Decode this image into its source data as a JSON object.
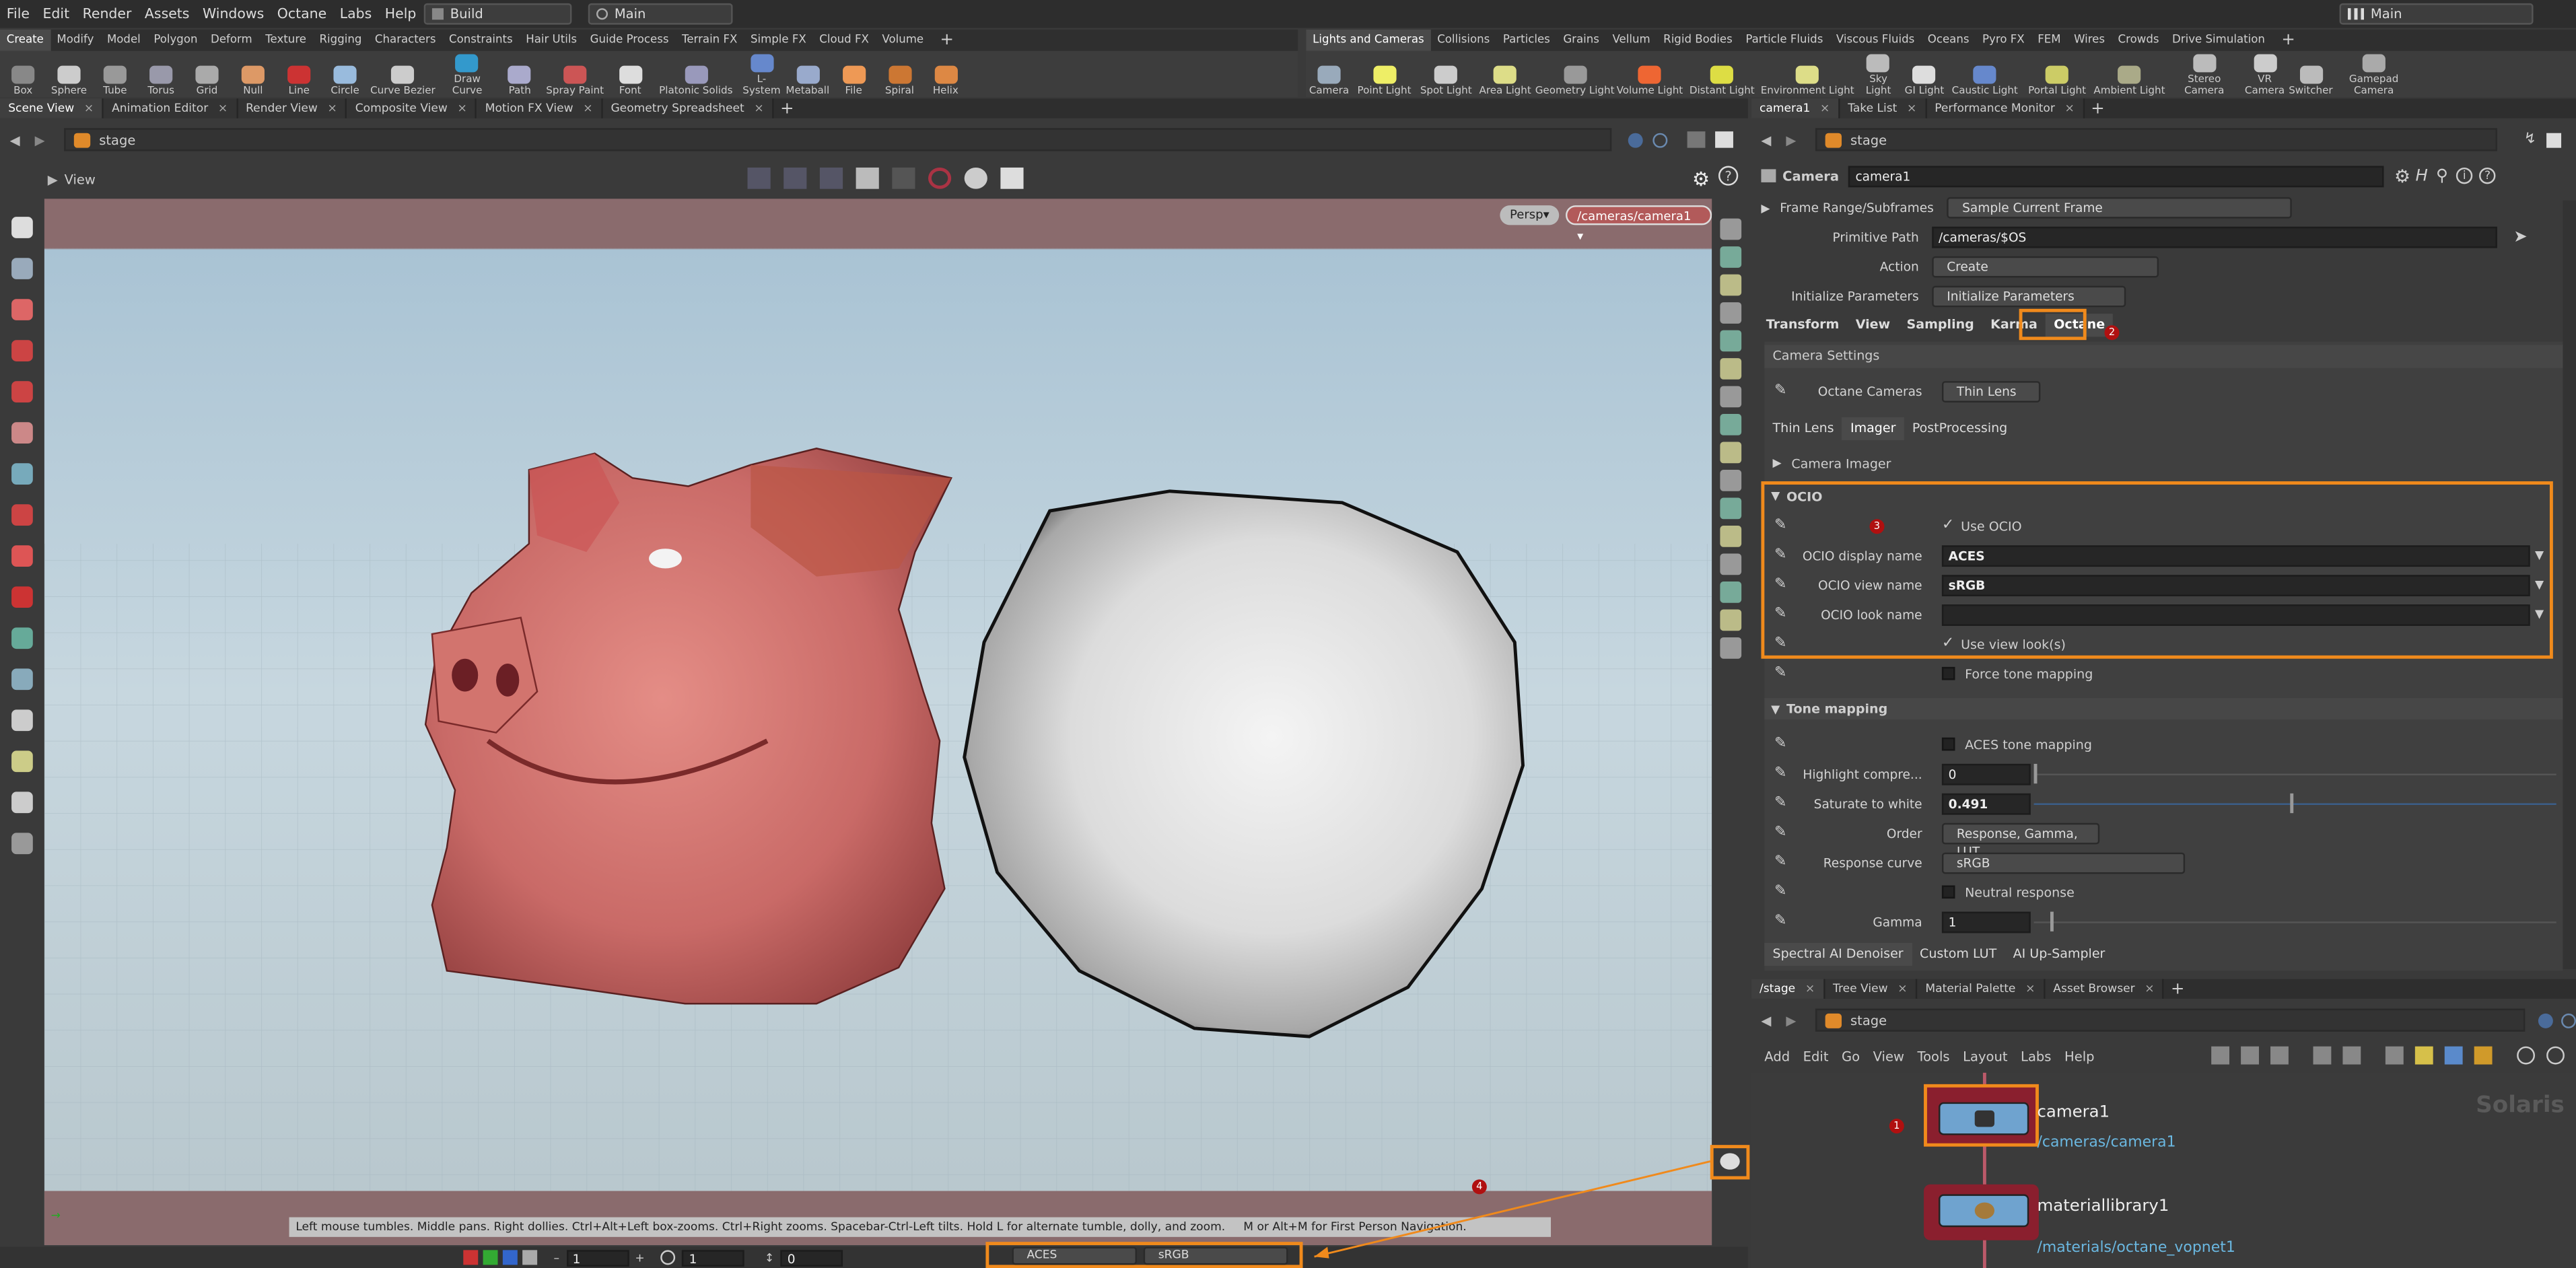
{
  "menubar": {
    "items": [
      "File",
      "Edit",
      "Render",
      "Assets",
      "Windows",
      "Octane",
      "Labs",
      "Help"
    ],
    "desktop": "Build",
    "workspace": "Main",
    "right_workspace": "Main"
  },
  "shelf_left": {
    "tabs": [
      "Create",
      "Modify",
      "Model",
      "Polygon",
      "Deform",
      "Texture",
      "Rigging",
      "Characters",
      "Constraints",
      "Hair Utils",
      "Guide Process",
      "Terrain FX",
      "Simple FX",
      "Cloud FX",
      "Volume"
    ],
    "tools": [
      "Box",
      "Sphere",
      "Tube",
      "Torus",
      "Grid",
      "Null",
      "Line",
      "Circle",
      "Curve Bezier",
      "Draw Curve",
      "Path",
      "Spray Paint",
      "Font",
      "Platonic Solids",
      "L-System",
      "Metaball",
      "File",
      "Spiral",
      "Helix"
    ]
  },
  "shelf_right": {
    "tabs": [
      "Lights and Cameras",
      "Collisions",
      "Particles",
      "Grains",
      "Vellum",
      "Rigid Bodies",
      "Particle Fluids",
      "Viscous Fluids",
      "Oceans",
      "Pyro FX",
      "FEM",
      "Wires",
      "Crowds",
      "Drive Simulation"
    ],
    "tools": [
      "Camera",
      "Point Light",
      "Spot Light",
      "Area Light",
      "Geometry Light",
      "Volume Light",
      "Distant Light",
      "Environment Light",
      "Sky Light",
      "GI Light",
      "Caustic Light",
      "Portal Light",
      "Ambient Light",
      "Stereo Camera",
      "VR Camera",
      "Switcher",
      "Gamepad Camera"
    ]
  },
  "left_panes": {
    "tabs": [
      "Scene View",
      "Animation Editor",
      "Render View",
      "Composite View",
      "Motion FX View",
      "Geometry Spreadsheet"
    ],
    "path": "stage",
    "view_label": "View",
    "persp": "Persp",
    "camera": "/cameras/camera1",
    "status_hint": "Left mouse tumbles. Middle pans. Right dollies. Ctrl+Alt+Left box-zooms. Ctrl+Right zooms. Spacebar-Ctrl-Left tilts. Hold L for alternate tumble, dolly, and zoom.     M or Alt+M for First Person Navigation.",
    "bottom_bar": {
      "field1": "1",
      "field2": "1",
      "field3": "0",
      "ocio_display": "ACES",
      "ocio_view": "sRGB"
    },
    "annotation_4": "4"
  },
  "params": {
    "tabs": [
      "camera1",
      "Take List",
      "Performance Monitor"
    ],
    "path": "stage",
    "node_type": "Camera",
    "node_name": "camera1",
    "frame_range_label": "Frame Range/Subframes",
    "frame_range_value": "Sample Current Frame",
    "prim_path_label": "Primitive Path",
    "prim_path_value": "/cameras/$OS",
    "action_label": "Action",
    "action_value": "Create",
    "init_label": "Initialize Parameters",
    "init_value": "Initialize Parameters",
    "main_tabs": [
      "Transform",
      "View",
      "Sampling",
      "Karma",
      "Octane"
    ],
    "annotation_2": "2",
    "camera_settings": "Camera Settings",
    "octane_cameras_label": "Octane Cameras",
    "octane_cameras_value": "Thin Lens",
    "sub_tabs": [
      "Thin Lens",
      "Imager",
      "PostProcessing"
    ],
    "camera_imager": "Camera Imager",
    "ocio_section": "OCIO",
    "annotation_3": "3",
    "use_ocio": "Use OCIO",
    "ocio_display_label": "OCIO display name",
    "ocio_display_value": "ACES",
    "ocio_view_label": "OCIO view name",
    "ocio_view_value": "sRGB",
    "ocio_look_label": "OCIO look name",
    "ocio_look_value": "",
    "use_view_looks": "Use view look(s)",
    "force_tone": "Force tone mapping",
    "tone_section": "Tone mapping",
    "aces_tone": "ACES tone mapping",
    "highlight_label": "Highlight compre...",
    "highlight_value": "0",
    "saturate_label": "Saturate to white",
    "saturate_value": "0.491",
    "order_label": "Order",
    "order_value": "Response, Gamma, LUT",
    "response_label": "Response curve",
    "response_value": "sRGB",
    "neutral": "Neutral response",
    "gamma_label": "Gamma",
    "gamma_value": "1",
    "bottom_tabs": [
      "Spectral AI Denoiser",
      "Custom LUT",
      "AI Up-Sampler"
    ]
  },
  "network": {
    "tabs": [
      "/stage",
      "Tree View",
      "Material Palette",
      "Asset Browser"
    ],
    "path": "stage",
    "menu": [
      "Add",
      "Edit",
      "Go",
      "View",
      "Tools",
      "Layout",
      "Labs",
      "Help"
    ],
    "context_label": "Solaris",
    "annotation_1": "1",
    "node1_name": "camera1",
    "node1_path": "/cameras/camera1",
    "node2_name": "materiallibrary1",
    "node2_path": "/materials/octane_vopnet1"
  },
  "colors": {
    "accent": "#f08a1c",
    "badge": "#b01010"
  }
}
